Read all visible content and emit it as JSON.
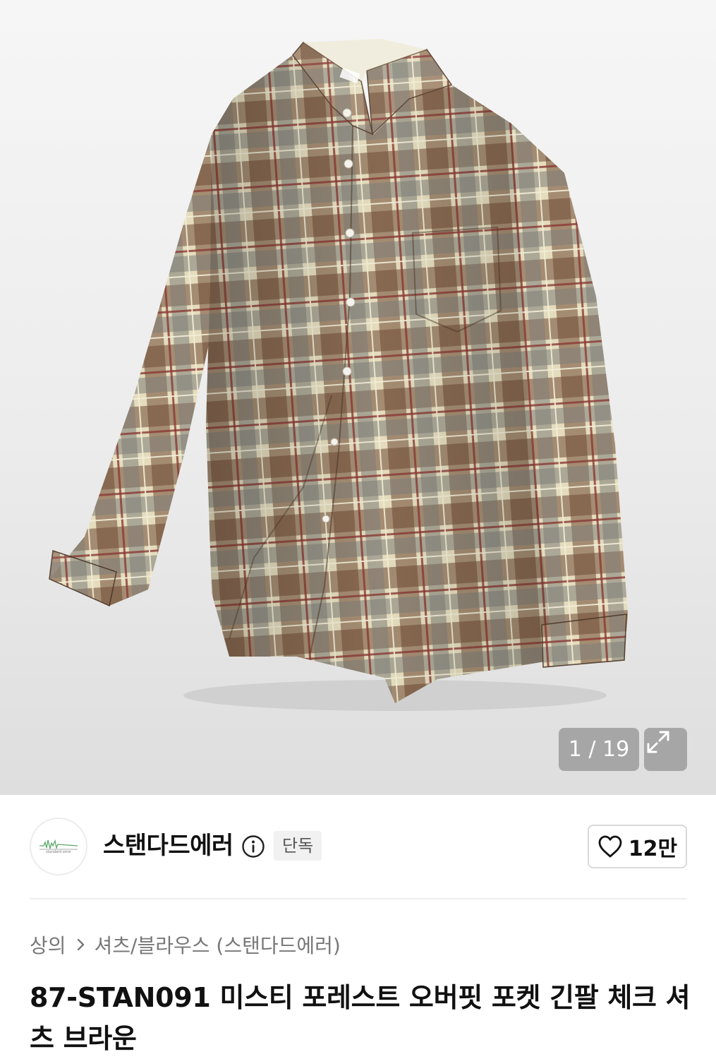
{
  "gallery": {
    "counter_text": "1 / 19",
    "current_index": 1,
    "total_images": 19,
    "expand_icon": "expand-icon"
  },
  "brand": {
    "name": "스탠다드에러",
    "logo_text": "standard error",
    "info_icon": "info-icon",
    "badge": "단독"
  },
  "like": {
    "icon": "heart-icon",
    "count": "12만"
  },
  "breadcrumb": {
    "category": "상의",
    "separator_icon": "chevron-right-icon",
    "subcategory": "셔츠/블라우스 (스탠다드에러)"
  },
  "product": {
    "title": "87-STAN091 미스티 포레스트 오버핏 포켓 긴팔 체크 셔츠 브라운"
  },
  "colors": {
    "plaid_brown": "#6e4a35",
    "plaid_gray": "#7d7d78",
    "plaid_cream": "#e4dcbd",
    "plaid_red": "#8a3a34",
    "overlay": "#969696"
  }
}
